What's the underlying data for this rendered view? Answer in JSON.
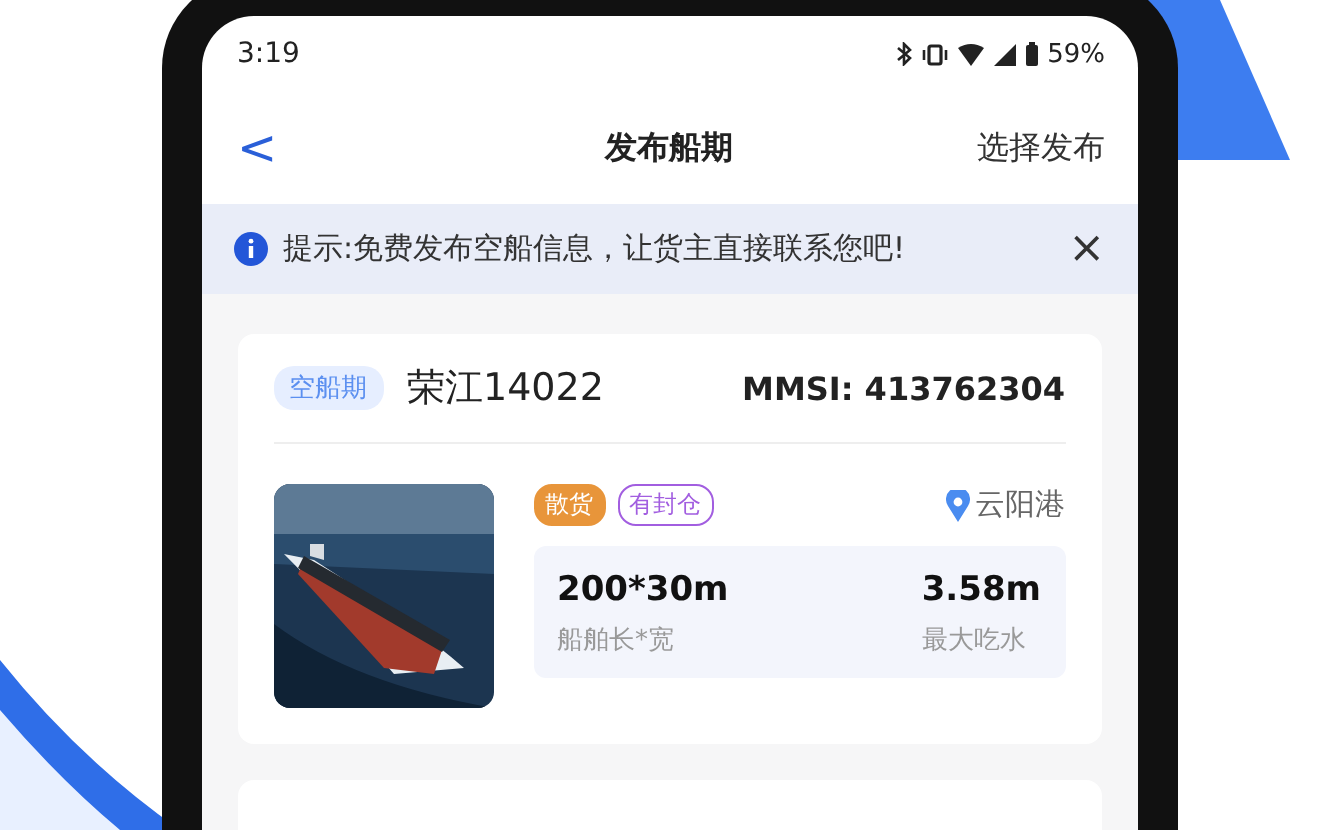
{
  "status_bar": {
    "time": "3:19",
    "battery": "59%"
  },
  "nav": {
    "back": "<",
    "title": "发布船期",
    "action": "选择发布"
  },
  "notice": {
    "text": "提示:免费发布空船信息，让货主直接联系您吧!",
    "close": "×"
  },
  "card": {
    "badge": "空船期",
    "ship_name": "荣江14022",
    "mmsi": "MMSI: 413762304",
    "tags": [
      {
        "label": "散货",
        "kind": "filled",
        "color": "#e8953a"
      },
      {
        "label": "有封仓",
        "kind": "outline",
        "color": "#a25ee0"
      }
    ],
    "port": "云阳港",
    "specs": [
      {
        "value": "200*30m",
        "label": "船舶长*宽"
      },
      {
        "value": "3.58m",
        "label": "最大吃水"
      }
    ]
  }
}
